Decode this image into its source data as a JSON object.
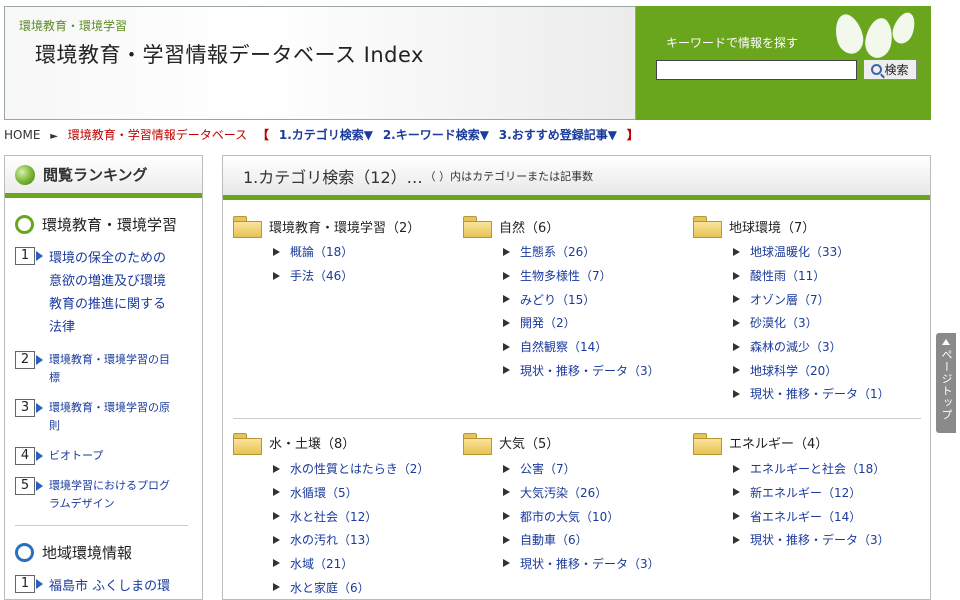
{
  "header": {
    "subtitle": "環境教育・環境学習",
    "title": "環境教育・学習情報データベース Index",
    "keyword_label": "キーワードで情報を探す",
    "search_value": "",
    "search_button": "検索"
  },
  "breadcrumb": {
    "home": "HOME",
    "current": "環境教育・学習情報データベース",
    "open": "【",
    "links": [
      "1.カテゴリ検索▼",
      "2.キーワード検索▼",
      "3.おすすめ登録記事▼"
    ],
    "close": "】"
  },
  "sidebar": {
    "heading": "閲覧ランキング",
    "sections": [
      {
        "title": "環境教育・環境学習",
        "items": [
          {
            "num": "1",
            "text": "環境の保全のための意欲の増進及び環境教育の推進に関する法律"
          },
          {
            "num": "2",
            "text": "環境教育・環境学習の目標"
          },
          {
            "num": "3",
            "text": "環境教育・環境学習の原則"
          },
          {
            "num": "4",
            "text": "ビオトープ"
          },
          {
            "num": "5",
            "text": "環境学習におけるプログラムデザイン"
          }
        ]
      },
      {
        "title": "地域環境情報",
        "items": [
          {
            "num": "1",
            "text": "福島市 ふくしまの環"
          }
        ]
      }
    ]
  },
  "main": {
    "heading": "1.カテゴリ検索（12）…",
    "note": "（ ）内はカテゴリーまたは記事数",
    "rows": [
      [
        {
          "name": "環境教育・環境学習（2）",
          "items": [
            "概論（18）",
            "手法（46）"
          ]
        },
        {
          "name": "自然（6）",
          "items": [
            "生態系（26）",
            "生物多様性（7）",
            "みどり（15）",
            "開発（2）",
            "自然観察（14）",
            "現状・推移・データ（3）"
          ]
        },
        {
          "name": "地球環境（7）",
          "items": [
            "地球温暖化（33）",
            "酸性雨（11）",
            "オゾン層（7）",
            "砂漠化（3）",
            "森林の減少（3）",
            "地球科学（20）",
            "現状・推移・データ（1）"
          ]
        }
      ],
      [
        {
          "name": "水・土壌（8）",
          "items": [
            "水の性質とはたらき（2）",
            "水循環（5）",
            "水と社会（12）",
            "水の汚れ（13）",
            "水域（21）",
            "水と家庭（6）"
          ]
        },
        {
          "name": "大気（5）",
          "items": [
            "公害（7）",
            "大気汚染（26）",
            "都市の大気（10）",
            "自動車（6）",
            "現状・推移・データ（3）"
          ]
        },
        {
          "name": "エネルギー（4）",
          "items": [
            "エネルギーと社会（18）",
            "新エネルギー（12）",
            "省エネルギー（14）",
            "現状・推移・データ（3）"
          ]
        }
      ]
    ]
  },
  "pagetop": "ページトップ"
}
